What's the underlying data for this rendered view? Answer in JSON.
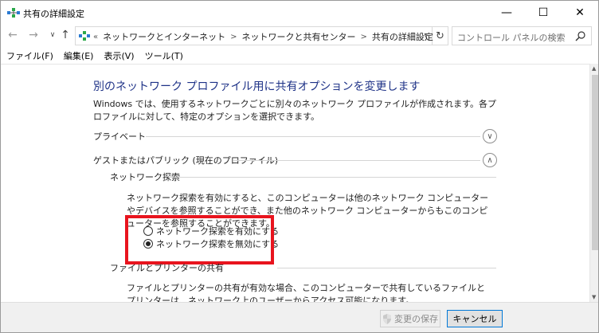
{
  "window": {
    "title": "共有の詳細設定",
    "minimize_glyph": "—",
    "maximize_glyph": "☐",
    "close_glyph": "✕"
  },
  "nav": {
    "back_glyph": "←",
    "forward_glyph": "→",
    "dropdown_glyph": "∨",
    "up_glyph": "↑",
    "refresh_glyph": "↻"
  },
  "address": {
    "overflow": "«",
    "breadcrumbs": [
      "ネットワークとインターネット",
      "ネットワークと共有センター",
      "共有の詳細設定"
    ],
    "separator": ">",
    "dropdown_glyph": "∨"
  },
  "search": {
    "placeholder": "コントロール パネルの検索"
  },
  "menu": {
    "items": [
      "ファイル(F)",
      "編集(E)",
      "表示(V)",
      "ツール(T)"
    ]
  },
  "page": {
    "title": "別のネットワーク プロファイル用に共有オプションを変更します",
    "description": "Windows では、使用するネットワークごとに別々のネットワーク プロファイルが作成されます。各プロファイルに対して、特定のオプションを選択できます。"
  },
  "profiles": {
    "private_label": "プライベート",
    "private_toggle": "∨",
    "guest_label": "ゲストまたはパブリック (現在のプロファイル)",
    "guest_toggle": "∧"
  },
  "network_discovery": {
    "heading": "ネットワーク探索",
    "description": "ネットワーク探索を有効にすると、このコンピューターは他のネットワーク コンピューターやデバイスを参照することができ、また他のネットワーク コンピューターからもこのコンピューターを参照することができます。",
    "options": [
      {
        "label": "ネットワーク探索を有効にする",
        "checked": false
      },
      {
        "label": "ネットワーク探索を無効にする",
        "checked": true
      }
    ]
  },
  "file_printer_sharing": {
    "heading": "ファイルとプリンターの共有",
    "description": "ファイルとプリンターの共有が有効な場合、このコンピューターで共有しているファイルとプリンターは、ネットワーク上のユーザーからアクセス可能になります。"
  },
  "buttons": {
    "save": "変更の保存",
    "cancel": "キャンセル"
  },
  "colors": {
    "title_blue": "#1e3287",
    "highlight_red": "#e8141e",
    "focus_blue": "#0078d7"
  }
}
